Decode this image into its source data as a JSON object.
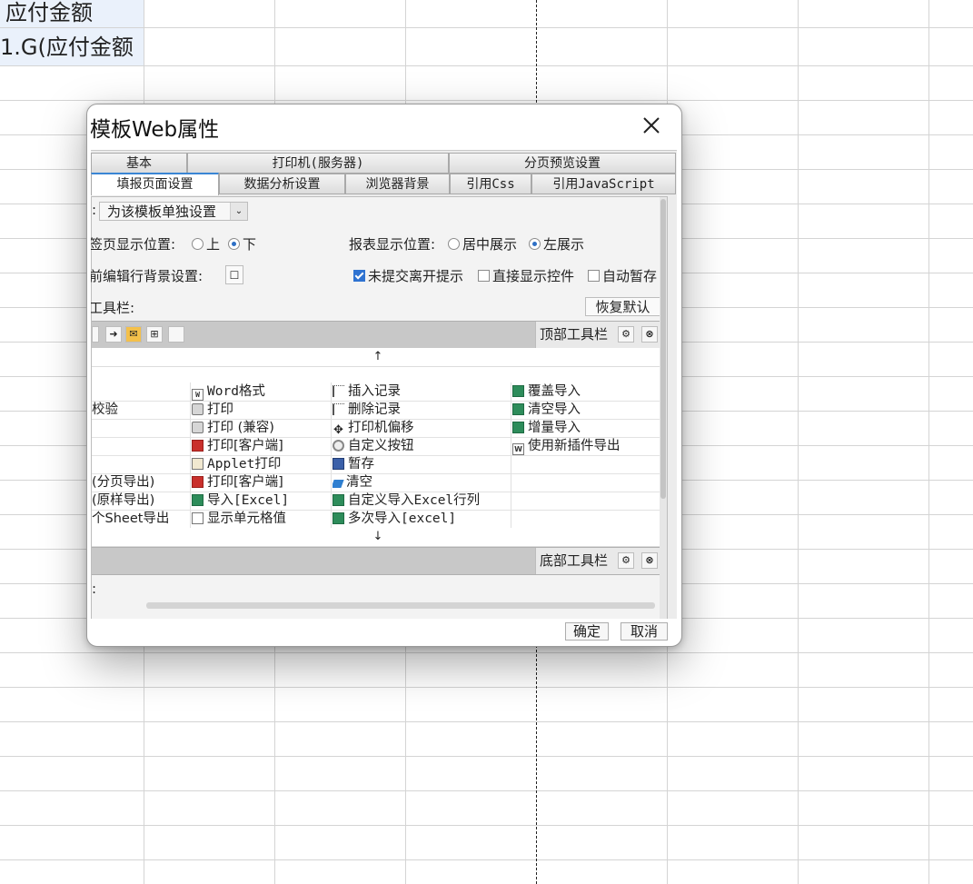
{
  "sheet": {
    "cells": [
      "应付金额",
      "1.G(应付金额"
    ]
  },
  "dialog": {
    "title": "模板Web属性",
    "tabs_row1": [
      "基本",
      "打印机(服务器)",
      "分页预览设置"
    ],
    "tabs_row2": [
      "填报页面设置",
      "数据分析设置",
      "浏览器背景",
      "引用Css",
      "引用JavaScript"
    ],
    "active_tab": "填报页面设置",
    "setting_prefix": ":",
    "setting_select": "为该模板单独设置",
    "sheet_position": {
      "label": "签页显示位置:",
      "options": [
        "上",
        "下"
      ],
      "selected": "下"
    },
    "report_position": {
      "label": "报表显示位置:",
      "options": [
        "居中展示",
        "左展示"
      ],
      "selected": "左展示"
    },
    "row_bg_label": "前编辑行背景设置:",
    "checkboxes": [
      {
        "label": "未提交离开提示",
        "checked": true
      },
      {
        "label": "直接显示控件",
        "checked": false
      },
      {
        "label": "自动暂存",
        "checked": false
      }
    ],
    "toolbar_label": "工具栏:",
    "restore_default": "恢复默认",
    "top_toolbar_label": "顶部工具栏",
    "bottom_toolbar_label": "底部工具栏",
    "arrow_up": "↑",
    "arrow_down": "↓",
    "bottom_partial": ":",
    "grid": {
      "col1": [
        "",
        "校验",
        "",
        "",
        "",
        "(分页导出)",
        "(原样导出)",
        "个Sheet导出"
      ],
      "col2": [
        {
          "text": "Word格式",
          "icon": "word-icon"
        },
        {
          "text": "打印",
          "icon": "printer-icon"
        },
        {
          "text": "打印 (兼容)",
          "icon": "printer-icon"
        },
        {
          "text": "打印[客户端]",
          "icon": "pdf-icon"
        },
        {
          "text": "Applet打印",
          "icon": "java-icon"
        },
        {
          "text": "打印[客户端]",
          "icon": "pdf-icon"
        },
        {
          "text": "导入[Excel]",
          "icon": "excel-icon"
        },
        {
          "text": "显示单元格值",
          "icon": "blank-icon"
        }
      ],
      "col3": [
        {
          "text": "插入记录",
          "icon": "insert-row-icon"
        },
        {
          "text": "删除记录",
          "icon": "delete-row-icon"
        },
        {
          "text": "打印机偏移",
          "icon": "move-icon"
        },
        {
          "text": "自定义按钮",
          "icon": "gear-icon"
        },
        {
          "text": "暂存",
          "icon": "save-icon"
        },
        {
          "text": "清空",
          "icon": "eraser-icon"
        },
        {
          "text": "自定义导入Excel行列",
          "icon": "excel-icon"
        },
        {
          "text": "多次导入[excel]",
          "icon": "excel-icon"
        }
      ],
      "col4": [
        {
          "text": "覆盖导入",
          "icon": "excel-icon"
        },
        {
          "text": "清空导入",
          "icon": "excel-icon"
        },
        {
          "text": "增量导入",
          "icon": "excel-icon"
        },
        {
          "text": "使用新插件导出",
          "icon": "word-icon"
        },
        {
          "text": "",
          "icon": ""
        },
        {
          "text": "",
          "icon": ""
        },
        {
          "text": "",
          "icon": ""
        },
        {
          "text": "",
          "icon": ""
        }
      ]
    },
    "ok_button": "确定",
    "cancel_button": "取消"
  }
}
